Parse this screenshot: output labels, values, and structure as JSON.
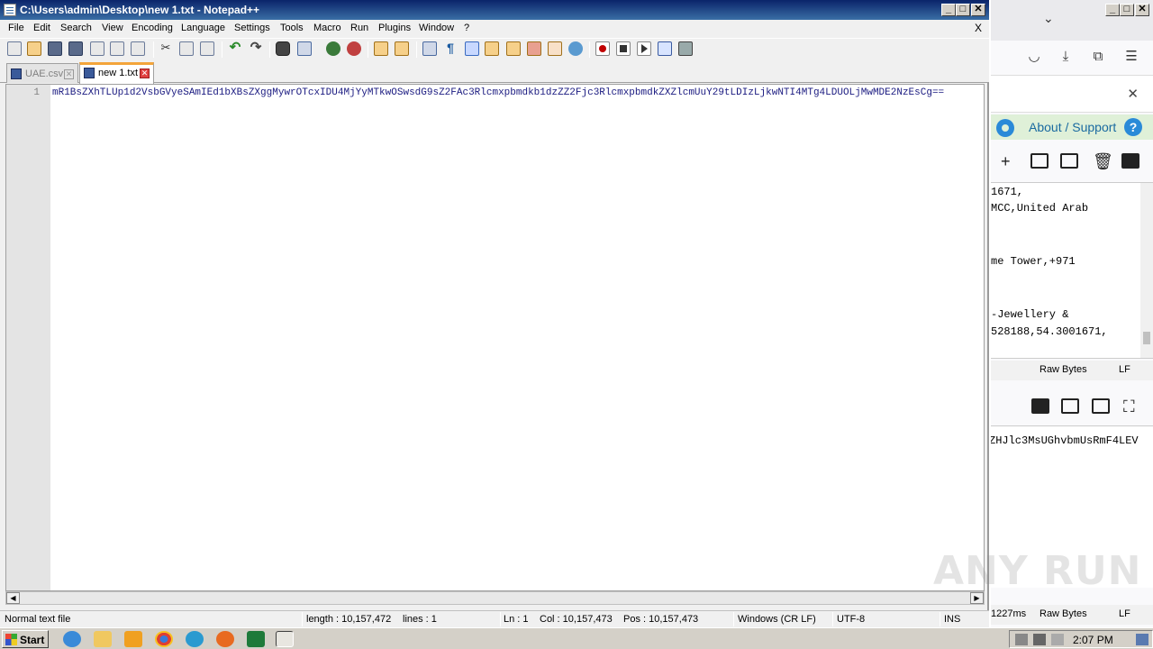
{
  "window": {
    "title": "C:\\Users\\admin\\Desktop\\new 1.txt - Notepad++",
    "min": "_",
    "max": "□",
    "close": "✕"
  },
  "menu": {
    "items": [
      "File",
      "Edit",
      "Search",
      "View",
      "Encoding",
      "Language",
      "Settings",
      "Tools",
      "Macro",
      "Run",
      "Plugins",
      "Window",
      "?"
    ],
    "close": "X"
  },
  "tabs": [
    {
      "label": "UAE.csv",
      "active": false
    },
    {
      "label": "new 1.txt",
      "active": true
    }
  ],
  "editor": {
    "line_number": "1",
    "text": "mR1BsZXhTLUp1d2VsbGVyeSAmIEd1bXBsZXggMywrOTcxIDU4MjYyMTkwOSwsdG9sZ2FAc3Rlcmxpbmdkb1dzZZ2Fjc3RlcmxpbmdkZXZlcmUuY29tLDIzLjkwNTI4MTg4LDUOLjMwMDE2NzEsCg=="
  },
  "status": {
    "type": "Normal text file",
    "length": "length : 10,157,472",
    "lines": "lines : 1",
    "ln": "Ln : 1",
    "col": "Col : 10,157,473",
    "pos": "Pos : 10,157,473",
    "eol": "Windows (CR LF)",
    "encoding": "UTF-8",
    "mode": "INS"
  },
  "browser": {
    "support_label": "About / Support",
    "input_lines": [
      "1671,",
      "MCC,United Arab",
      "me Tower,+971",
      "-Jewellery &",
      "528188,54.3001671,"
    ],
    "raw_bytes": "Raw Bytes",
    "lf": "LF",
    "time": "1227ms",
    "output_text": "ZHJlc3MsUGhvbmUsRmF4LEV",
    "watermark": "ANY RUN"
  },
  "taskbar": {
    "start": "Start",
    "clock": "2:07 PM"
  }
}
